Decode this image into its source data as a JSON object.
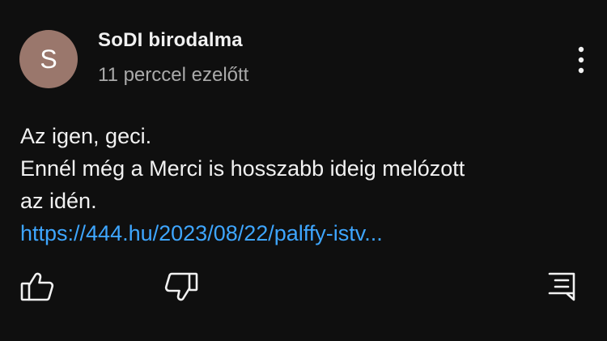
{
  "comment": {
    "avatar_letter": "S",
    "author": "SoDI birodalma",
    "timestamp": "11 perccel ezelőtt",
    "lines": [
      "Az igen, geci.",
      "Ennél még a Merci is hosszabb ideig melózott",
      "az idén."
    ],
    "link_text": "https://444.hu/2023/08/22/palffy-istv..."
  },
  "actions": {
    "more_icon": "more-vertical-icon",
    "like_icon": "thumbs-up-icon",
    "dislike_icon": "thumbs-down-icon",
    "reply_icon": "comment-reply-icon"
  },
  "colors": {
    "background": "#0f0f0f",
    "text": "#f1f1f1",
    "secondary_text": "#aaaaaa",
    "link": "#3ea6ff",
    "avatar": "#9a776c"
  }
}
